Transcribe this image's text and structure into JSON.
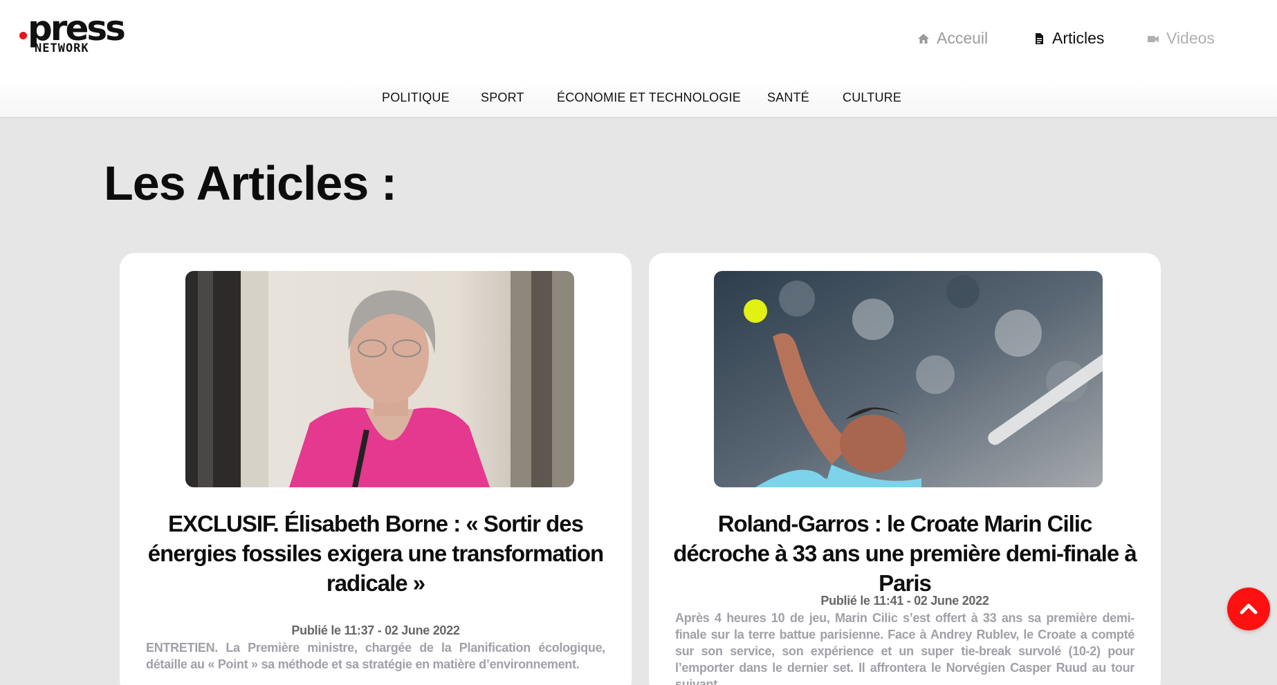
{
  "brand": {
    "logo_main": "press",
    "logo_sub": "NETWORK"
  },
  "nav": [
    {
      "label": "Acceuil",
      "icon": "home-icon",
      "active": false
    },
    {
      "label": "Articles",
      "icon": "document-icon",
      "active": true
    },
    {
      "label": "Videos",
      "icon": "video-camera-icon",
      "active": false
    }
  ],
  "categories": [
    "POLITIQUE",
    "SPORT",
    "ÉCONOMIE ET TECHNOLOGIE",
    "SANTÉ",
    "CULTURE"
  ],
  "page_title": "Les Articles :",
  "articles": [
    {
      "title": "EXCLUSIF. Élisabeth Borne : « Sortir des énergies fossiles exigera une transformation radicale »",
      "date": "Publié le 11:37 - 02 June 2022",
      "excerpt": "ENTRETIEN. La Première ministre, chargée de la Planification écologique, détaille au « Point » sa méthode et sa stratégie en matière d’environnement."
    },
    {
      "title": "Roland-Garros : le Croate Marin Cilic décroche à 33 ans une première demi-finale à Paris",
      "date": "Publié le 11:41 - 02 June 2022",
      "excerpt": "Après 4 heures 10 de jeu, Marin Cilic s’est offert à 33 ans sa première demi-finale sur la terre battue parisienne. Face à Andrey Rublev, le Croate a compté sur son service, son expérience et un super tie-break survolé (10-2) pour l’emporter dans le dernier set. Il affrontera le Norvégien Casper Ruud au tour suivant."
    }
  ],
  "colors": {
    "accent": "#ff1010",
    "background": "#e6e6e6",
    "logo_dot": "#e8141a"
  },
  "scroll_top_icon": "chevron-up-icon"
}
